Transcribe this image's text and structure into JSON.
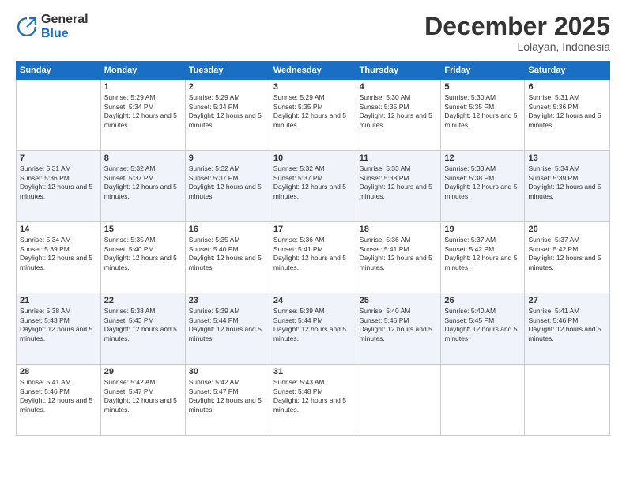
{
  "logo": {
    "general": "General",
    "blue": "Blue"
  },
  "title": "December 2025",
  "location": "Lolayan, Indonesia",
  "days_of_week": [
    "Sunday",
    "Monday",
    "Tuesday",
    "Wednesday",
    "Thursday",
    "Friday",
    "Saturday"
  ],
  "weeks": [
    [
      {
        "day": "",
        "sunrise": "",
        "sunset": "",
        "daylight": ""
      },
      {
        "day": "1",
        "sunrise": "Sunrise: 5:29 AM",
        "sunset": "Sunset: 5:34 PM",
        "daylight": "Daylight: 12 hours and 5 minutes."
      },
      {
        "day": "2",
        "sunrise": "Sunrise: 5:29 AM",
        "sunset": "Sunset: 5:34 PM",
        "daylight": "Daylight: 12 hours and 5 minutes."
      },
      {
        "day": "3",
        "sunrise": "Sunrise: 5:29 AM",
        "sunset": "Sunset: 5:35 PM",
        "daylight": "Daylight: 12 hours and 5 minutes."
      },
      {
        "day": "4",
        "sunrise": "Sunrise: 5:30 AM",
        "sunset": "Sunset: 5:35 PM",
        "daylight": "Daylight: 12 hours and 5 minutes."
      },
      {
        "day": "5",
        "sunrise": "Sunrise: 5:30 AM",
        "sunset": "Sunset: 5:35 PM",
        "daylight": "Daylight: 12 hours and 5 minutes."
      },
      {
        "day": "6",
        "sunrise": "Sunrise: 5:31 AM",
        "sunset": "Sunset: 5:36 PM",
        "daylight": "Daylight: 12 hours and 5 minutes."
      }
    ],
    [
      {
        "day": "7",
        "sunrise": "Sunrise: 5:31 AM",
        "sunset": "Sunset: 5:36 PM",
        "daylight": "Daylight: 12 hours and 5 minutes."
      },
      {
        "day": "8",
        "sunrise": "Sunrise: 5:32 AM",
        "sunset": "Sunset: 5:37 PM",
        "daylight": "Daylight: 12 hours and 5 minutes."
      },
      {
        "day": "9",
        "sunrise": "Sunrise: 5:32 AM",
        "sunset": "Sunset: 5:37 PM",
        "daylight": "Daylight: 12 hours and 5 minutes."
      },
      {
        "day": "10",
        "sunrise": "Sunrise: 5:32 AM",
        "sunset": "Sunset: 5:37 PM",
        "daylight": "Daylight: 12 hours and 5 minutes."
      },
      {
        "day": "11",
        "sunrise": "Sunrise: 5:33 AM",
        "sunset": "Sunset: 5:38 PM",
        "daylight": "Daylight: 12 hours and 5 minutes."
      },
      {
        "day": "12",
        "sunrise": "Sunrise: 5:33 AM",
        "sunset": "Sunset: 5:38 PM",
        "daylight": "Daylight: 12 hours and 5 minutes."
      },
      {
        "day": "13",
        "sunrise": "Sunrise: 5:34 AM",
        "sunset": "Sunset: 5:39 PM",
        "daylight": "Daylight: 12 hours and 5 minutes."
      }
    ],
    [
      {
        "day": "14",
        "sunrise": "Sunrise: 5:34 AM",
        "sunset": "Sunset: 5:39 PM",
        "daylight": "Daylight: 12 hours and 5 minutes."
      },
      {
        "day": "15",
        "sunrise": "Sunrise: 5:35 AM",
        "sunset": "Sunset: 5:40 PM",
        "daylight": "Daylight: 12 hours and 5 minutes."
      },
      {
        "day": "16",
        "sunrise": "Sunrise: 5:35 AM",
        "sunset": "Sunset: 5:40 PM",
        "daylight": "Daylight: 12 hours and 5 minutes."
      },
      {
        "day": "17",
        "sunrise": "Sunrise: 5:36 AM",
        "sunset": "Sunset: 5:41 PM",
        "daylight": "Daylight: 12 hours and 5 minutes."
      },
      {
        "day": "18",
        "sunrise": "Sunrise: 5:36 AM",
        "sunset": "Sunset: 5:41 PM",
        "daylight": "Daylight: 12 hours and 5 minutes."
      },
      {
        "day": "19",
        "sunrise": "Sunrise: 5:37 AM",
        "sunset": "Sunset: 5:42 PM",
        "daylight": "Daylight: 12 hours and 5 minutes."
      },
      {
        "day": "20",
        "sunrise": "Sunrise: 5:37 AM",
        "sunset": "Sunset: 5:42 PM",
        "daylight": "Daylight: 12 hours and 5 minutes."
      }
    ],
    [
      {
        "day": "21",
        "sunrise": "Sunrise: 5:38 AM",
        "sunset": "Sunset: 5:43 PM",
        "daylight": "Daylight: 12 hours and 5 minutes."
      },
      {
        "day": "22",
        "sunrise": "Sunrise: 5:38 AM",
        "sunset": "Sunset: 5:43 PM",
        "daylight": "Daylight: 12 hours and 5 minutes."
      },
      {
        "day": "23",
        "sunrise": "Sunrise: 5:39 AM",
        "sunset": "Sunset: 5:44 PM",
        "daylight": "Daylight: 12 hours and 5 minutes."
      },
      {
        "day": "24",
        "sunrise": "Sunrise: 5:39 AM",
        "sunset": "Sunset: 5:44 PM",
        "daylight": "Daylight: 12 hours and 5 minutes."
      },
      {
        "day": "25",
        "sunrise": "Sunrise: 5:40 AM",
        "sunset": "Sunset: 5:45 PM",
        "daylight": "Daylight: 12 hours and 5 minutes."
      },
      {
        "day": "26",
        "sunrise": "Sunrise: 5:40 AM",
        "sunset": "Sunset: 5:45 PM",
        "daylight": "Daylight: 12 hours and 5 minutes."
      },
      {
        "day": "27",
        "sunrise": "Sunrise: 5:41 AM",
        "sunset": "Sunset: 5:46 PM",
        "daylight": "Daylight: 12 hours and 5 minutes."
      }
    ],
    [
      {
        "day": "28",
        "sunrise": "Sunrise: 5:41 AM",
        "sunset": "Sunset: 5:46 PM",
        "daylight": "Daylight: 12 hours and 5 minutes."
      },
      {
        "day": "29",
        "sunrise": "Sunrise: 5:42 AM",
        "sunset": "Sunset: 5:47 PM",
        "daylight": "Daylight: 12 hours and 5 minutes."
      },
      {
        "day": "30",
        "sunrise": "Sunrise: 5:42 AM",
        "sunset": "Sunset: 5:47 PM",
        "daylight": "Daylight: 12 hours and 5 minutes."
      },
      {
        "day": "31",
        "sunrise": "Sunrise: 5:43 AM",
        "sunset": "Sunset: 5:48 PM",
        "daylight": "Daylight: 12 hours and 5 minutes."
      },
      {
        "day": "",
        "sunrise": "",
        "sunset": "",
        "daylight": ""
      },
      {
        "day": "",
        "sunrise": "",
        "sunset": "",
        "daylight": ""
      },
      {
        "day": "",
        "sunrise": "",
        "sunset": "",
        "daylight": ""
      }
    ]
  ]
}
